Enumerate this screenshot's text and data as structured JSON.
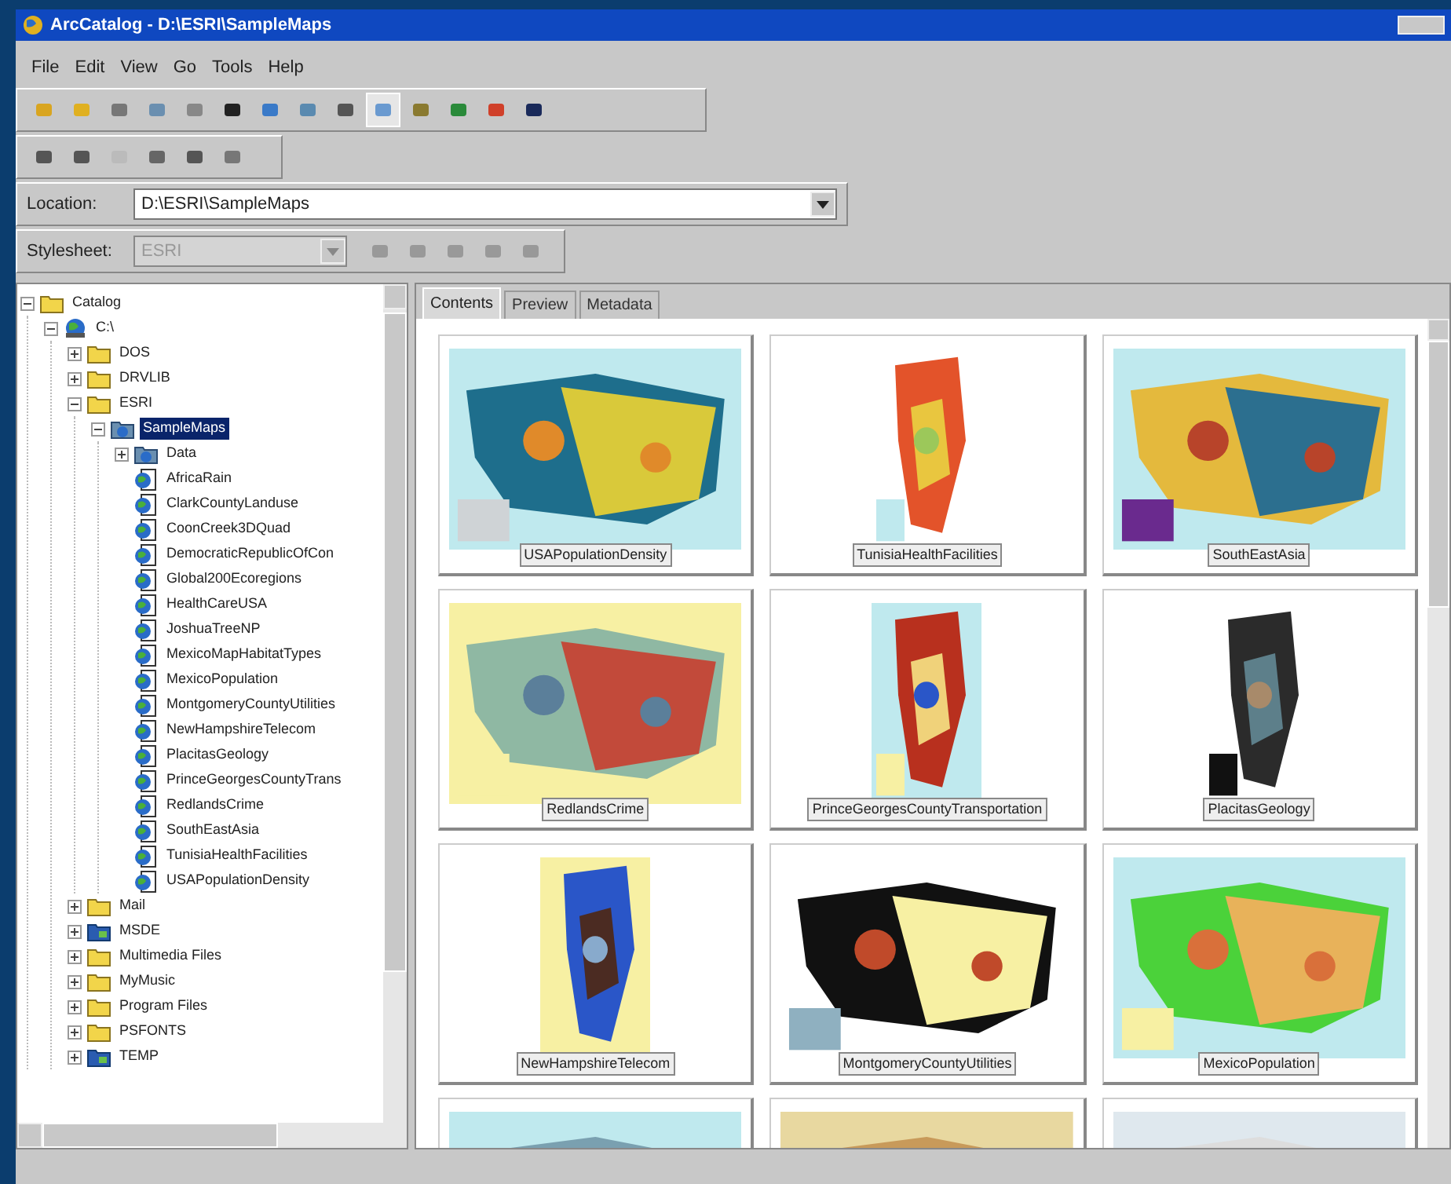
{
  "window": {
    "title": "ArcCatalog - D:\\ESRI\\SampleMaps"
  },
  "menu": [
    "File",
    "Edit",
    "View",
    "Go",
    "Tools",
    "Help"
  ],
  "location": {
    "label": "Location:",
    "value": "D:\\ESRI\\SampleMaps"
  },
  "stylesheet": {
    "label": "Stylesheet:",
    "value": "ESRI",
    "disabled": true
  },
  "tree": [
    {
      "label": "Catalog",
      "kind": "catalog",
      "selected": false,
      "expanded": true,
      "children": [
        {
          "label": "C:\\",
          "kind": "drive",
          "selected": false,
          "expanded": true,
          "children": [
            {
              "label": "DOS",
              "kind": "folder",
              "selected": false,
              "expanded": false
            },
            {
              "label": "DRVLIB",
              "kind": "folder",
              "selected": false,
              "expanded": false
            },
            {
              "label": "ESRI",
              "kind": "folder",
              "selected": false,
              "expanded": true,
              "children": [
                {
                  "label": "SampleMaps",
                  "kind": "mapfolder",
                  "selected": true,
                  "expanded": true,
                  "children": [
                    {
                      "label": "Data",
                      "kind": "mapfolder",
                      "selected": false,
                      "expanded": false
                    },
                    {
                      "label": "AfricaRain",
                      "kind": "map",
                      "selected": false
                    },
                    {
                      "label": "ClarkCountyLanduse",
                      "kind": "map",
                      "selected": false
                    },
                    {
                      "label": "CoonCreek3DQuad",
                      "kind": "map",
                      "selected": false
                    },
                    {
                      "label": "DemocraticRepublicOfCon",
                      "kind": "map",
                      "selected": false
                    },
                    {
                      "label": "Global200Ecoregions",
                      "kind": "map",
                      "selected": false
                    },
                    {
                      "label": "HealthCareUSA",
                      "kind": "map",
                      "selected": false
                    },
                    {
                      "label": "JoshuaTreeNP",
                      "kind": "map",
                      "selected": false
                    },
                    {
                      "label": "MexicoMapHabitatTypes",
                      "kind": "map",
                      "selected": false
                    },
                    {
                      "label": "MexicoPopulation",
                      "kind": "map",
                      "selected": false
                    },
                    {
                      "label": "MontgomeryCountyUtilities",
                      "kind": "map",
                      "selected": false
                    },
                    {
                      "label": "NewHampshireTelecom",
                      "kind": "map",
                      "selected": false
                    },
                    {
                      "label": "PlacitasGeology",
                      "kind": "map",
                      "selected": false
                    },
                    {
                      "label": "PrinceGeorgesCountyTrans",
                      "kind": "map",
                      "selected": false
                    },
                    {
                      "label": "RedlandsCrime",
                      "kind": "map",
                      "selected": false
                    },
                    {
                      "label": "SouthEastAsia",
                      "kind": "map",
                      "selected": false
                    },
                    {
                      "label": "TunisiaHealthFacilities",
                      "kind": "map",
                      "selected": false
                    },
                    {
                      "label": "USAPopulationDensity",
                      "kind": "map",
                      "selected": false
                    }
                  ]
                }
              ]
            },
            {
              "label": "Mail",
              "kind": "folder",
              "selected": false,
              "expanded": false
            },
            {
              "label": "MSDE",
              "kind": "special",
              "selected": false,
              "expanded": false
            },
            {
              "label": "Multimedia Files",
              "kind": "folder",
              "selected": false,
              "expanded": false
            },
            {
              "label": "MyMusic",
              "kind": "folder",
              "selected": false,
              "expanded": false
            },
            {
              "label": "Program Files",
              "kind": "folder",
              "selected": false,
              "expanded": false
            },
            {
              "label": "PSFONTS",
              "kind": "folder",
              "selected": false,
              "expanded": false
            },
            {
              "label": "TEMP",
              "kind": "special",
              "selected": false,
              "expanded": false
            }
          ]
        }
      ]
    }
  ],
  "tabs": [
    {
      "label": "Contents",
      "selected": true
    },
    {
      "label": "Preview",
      "selected": false
    },
    {
      "label": "Metadata",
      "selected": false
    }
  ],
  "thumbnails": [
    {
      "label": "USAPopulationDensity",
      "kind": "picture"
    },
    {
      "label": "TunisiaHealthFacilities",
      "kind": "picture"
    },
    {
      "label": "SouthEastAsia",
      "kind": "picture"
    },
    {
      "label": "RedlandsCrime",
      "kind": "picture"
    },
    {
      "label": "PrinceGeorgesCountyTransportation",
      "kind": "picture"
    },
    {
      "label": "PlacitasGeology",
      "kind": "picture"
    },
    {
      "label": "NewHampshireTelecom",
      "kind": "picture"
    },
    {
      "label": "MontgomeryCountyUtilities",
      "kind": "picture"
    },
    {
      "label": "MexicoPopulation",
      "kind": "picture"
    },
    {
      "kind": "picture"
    },
    {
      "kind": "picture"
    },
    {
      "kind": "picture"
    }
  ]
}
